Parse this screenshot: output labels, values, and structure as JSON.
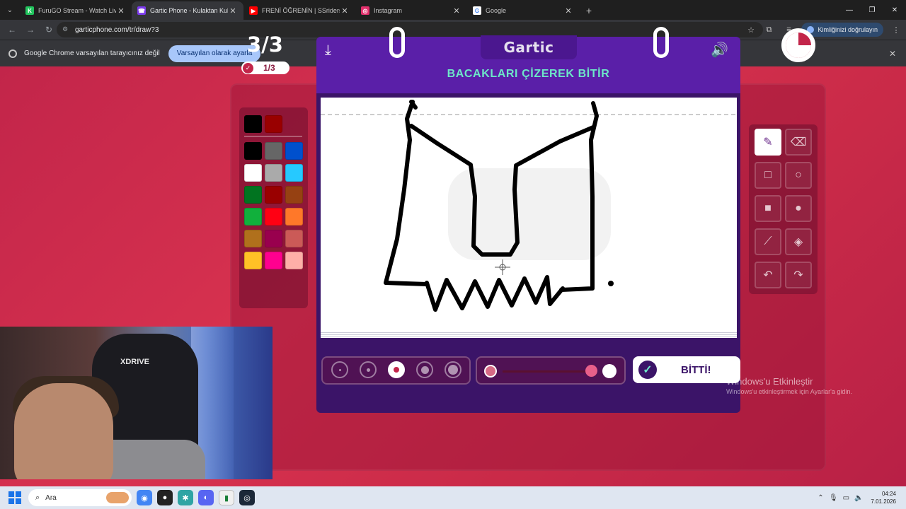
{
  "browser": {
    "tabs": [
      {
        "title": "FuruGO Stream - Watch Live on",
        "favicon_color": "#22c55e",
        "favicon_letter": "K",
        "active": false
      },
      {
        "title": "Gartic Phone - Kulaktan Kulağa",
        "favicon_color": "#7c3aed",
        "favicon_letter": "☎",
        "active": true
      },
      {
        "title": "FRENİ ÖĞRENİN | SSriders | Mo",
        "favicon_color": "#ff0000",
        "favicon_letter": "▶",
        "active": false
      },
      {
        "title": "Instagram",
        "favicon_color": "#e1306c",
        "favicon_letter": "◎",
        "active": false
      },
      {
        "title": "Google",
        "favicon_color": "#ffffff",
        "favicon_letter": "G",
        "active": false
      }
    ],
    "url": "garticphone.com/tr/draw?3",
    "profile_label": "Kimliğinizi doğrulayın",
    "infobar": {
      "message": "Google Chrome varsayılan tarayıcınız değil",
      "button": "Varsayılan olarak ayarla"
    }
  },
  "game": {
    "round": "3/3",
    "progress": "1/3",
    "logo": "Gartic",
    "prompt": "BACAKLARI ÇİZEREK BİTİR",
    "done_label": "BİTTİ!",
    "selected_tool": "pencil",
    "selected_size_index": 2,
    "palette_current": [
      "#000000",
      "#990000"
    ],
    "palette": [
      "#000000",
      "#666666",
      "#0050cd",
      "#ffffff",
      "#aaaaaa",
      "#26c9ff",
      "#017420",
      "#990000",
      "#964112",
      "#11b03c",
      "#ff0013",
      "#ff7829",
      "#b0701c",
      "#99004e",
      "#cb5a57",
      "#ffc126",
      "#ff008f",
      "#feafa8"
    ],
    "tools": [
      {
        "name": "pencil-icon",
        "glyph": "✎"
      },
      {
        "name": "eraser-icon",
        "glyph": "⌫"
      },
      {
        "name": "rectangle-outline-icon",
        "glyph": "□"
      },
      {
        "name": "ellipse-outline-icon",
        "glyph": "○"
      },
      {
        "name": "rectangle-filled-icon",
        "glyph": "■"
      },
      {
        "name": "ellipse-filled-icon",
        "glyph": "●"
      },
      {
        "name": "line-icon",
        "glyph": "⟋"
      },
      {
        "name": "fill-bucket-icon",
        "glyph": "◈"
      },
      {
        "name": "undo-icon",
        "glyph": "↶"
      },
      {
        "name": "redo-icon",
        "glyph": "↷"
      }
    ]
  },
  "windows": {
    "activation_title": "Windows'u Etkinleştir",
    "activation_sub": "Windows'u etkinleştirmek için Ayarlar'a gidin.",
    "search_placeholder": "Ara",
    "time": "04:24",
    "date": "7.01.2026"
  },
  "webcam": {
    "chair_brand": "XDRIVE"
  }
}
